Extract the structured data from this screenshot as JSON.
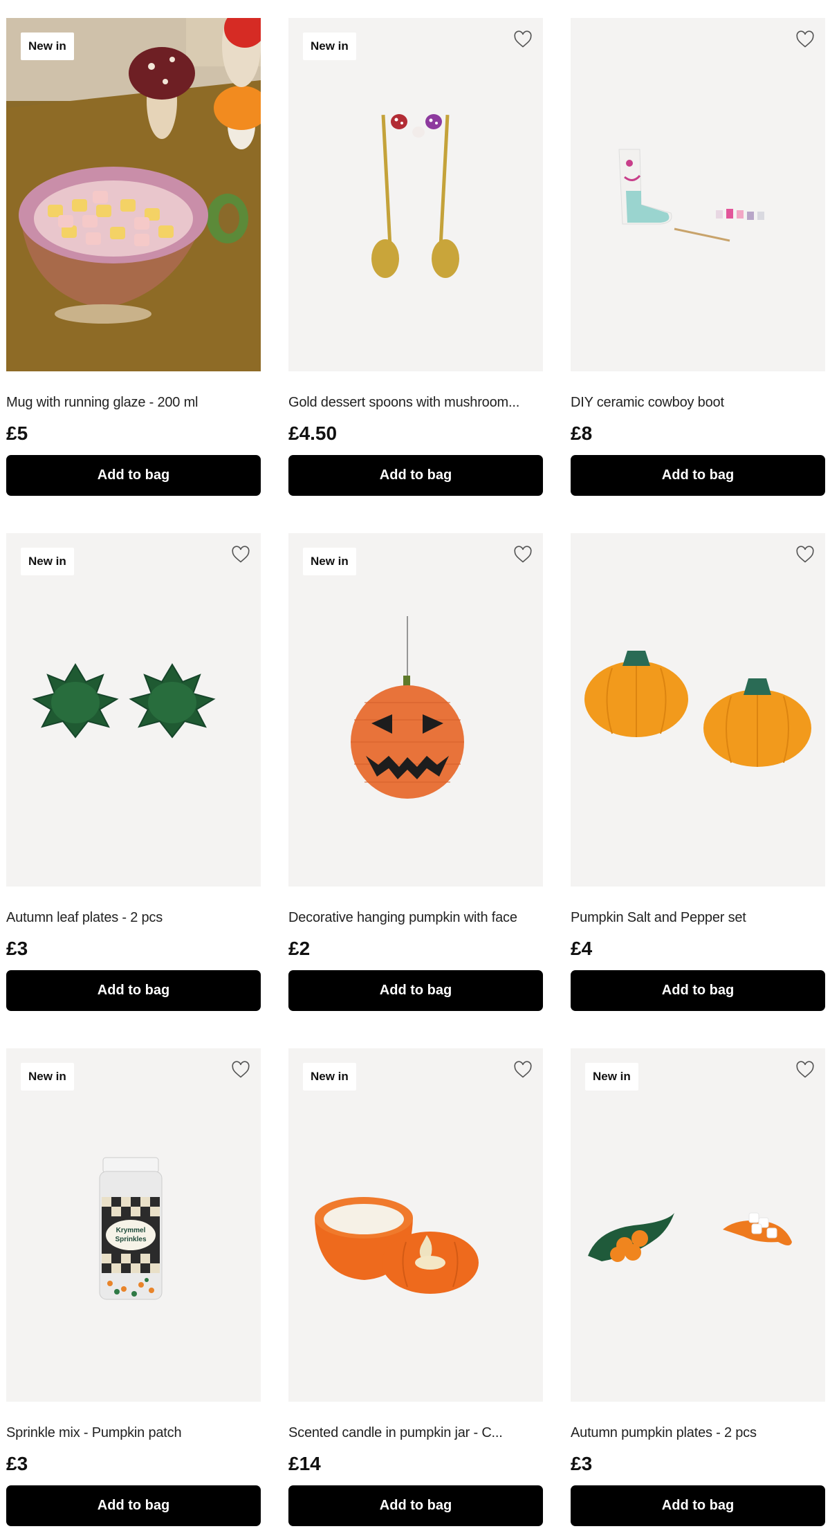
{
  "products": [
    {
      "title": "Mug with running glaze - 200 ml",
      "price": "£5",
      "badge": "New in",
      "button": "Add to bag",
      "image": "mug-image",
      "favorite_icon": false
    },
    {
      "title": "Gold dessert spoons with mushroom...",
      "price": "£4.50",
      "badge": "New in",
      "button": "Add to bag",
      "image": "spoons-image",
      "favorite_icon": true
    },
    {
      "title": "DIY ceramic cowboy boot",
      "price": "£8",
      "badge": "",
      "button": "Add to bag",
      "image": "boot-image",
      "favorite_icon": true
    },
    {
      "title": "Autumn leaf plates - 2 pcs",
      "price": "£3",
      "badge": "New in",
      "button": "Add to bag",
      "image": "leaf-plates-image",
      "favorite_icon": true
    },
    {
      "title": "Decorative hanging pumpkin with face",
      "price": "£2",
      "badge": "New in",
      "button": "Add to bag",
      "image": "hanging-pumpkin-image",
      "favorite_icon": true
    },
    {
      "title": "Pumpkin Salt and Pepper set",
      "price": "£4",
      "badge": "",
      "button": "Add to bag",
      "image": "salt-pepper-image",
      "favorite_icon": true
    },
    {
      "title": "Sprinkle mix - Pumpkin patch",
      "price": "£3",
      "badge": "New in",
      "button": "Add to bag",
      "image": "sprinkles-image",
      "favorite_icon": true,
      "image_text": [
        "Krymmel",
        "Sprinkles"
      ]
    },
    {
      "title": "Scented candle in pumpkin jar - C...",
      "price": "£14",
      "badge": "New in",
      "button": "Add to bag",
      "image": "candle-image",
      "favorite_icon": true
    },
    {
      "title": "Autumn pumpkin plates - 2 pcs",
      "price": "£3",
      "badge": "New in",
      "button": "Add to bag",
      "image": "pumpkin-plates-image",
      "favorite_icon": true
    }
  ],
  "colors": {
    "button_bg": "#000000",
    "button_text": "#ffffff",
    "tile_bg": "#f4f3f2",
    "badge_bg": "#ffffff"
  }
}
